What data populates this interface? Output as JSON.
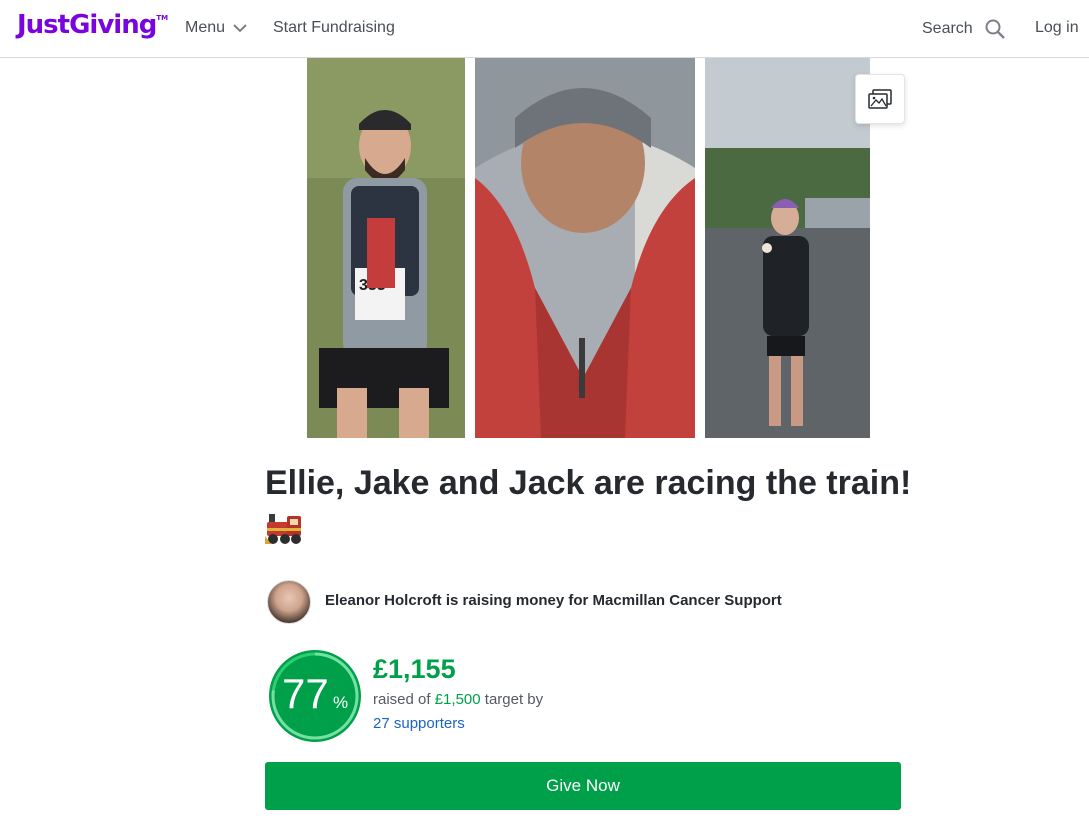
{
  "header": {
    "logo": "JustGiving",
    "logo_tm": "TM",
    "menu_label": "Menu",
    "start_label": "Start Fundraising",
    "search_label": "Search",
    "login_label": "Log in"
  },
  "page": {
    "title": "Ellie, Jake and Jack are racing the train!",
    "title_emoji": "🚂",
    "organiser_text": "Eleanor Holcroft is raising money for Macmillan Cancer Support"
  },
  "progress": {
    "percent": "77",
    "percent_sign": "%",
    "percent_value": 0.77,
    "raised": "£1,155",
    "raised_prefix": "raised of",
    "target": "£1,500",
    "raised_suffix": "target by",
    "supporters": "27 supporters"
  },
  "cta": {
    "give_label": "Give Now"
  },
  "icons": {
    "menu_chevron": "chevron-down-icon",
    "search": "search-icon",
    "gallery": "image-gallery-icon"
  },
  "colors": {
    "brand": "#7a04dd",
    "accent_green": "#00a04a",
    "link_blue": "#1a63c9"
  }
}
